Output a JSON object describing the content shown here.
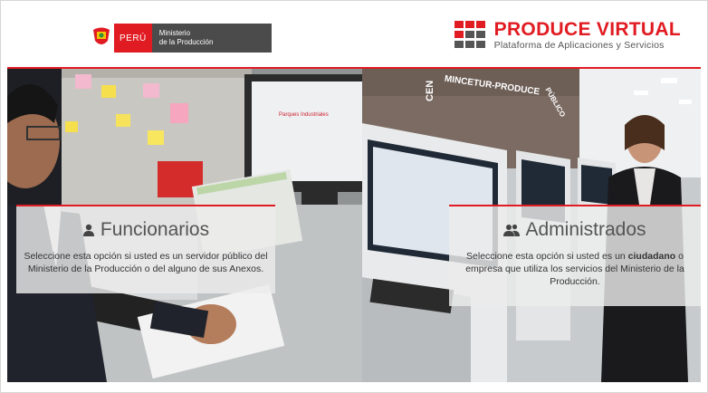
{
  "header": {
    "gov_logo": {
      "country": "PERÚ",
      "ministry_line1": "Ministerio",
      "ministry_line2": "de la Producción"
    },
    "brand": {
      "title": "PRODUCE VIRTUAL",
      "subtitle": "Plataforma de Aplicaciones y Servicios"
    }
  },
  "scene": {
    "monitor_text": "Parques Industriales",
    "wall_text_1": "MINCETUR-PRODUCE",
    "wall_text_2": "CEN",
    "wall_text_3": "PÚBLICO"
  },
  "options": [
    {
      "title": "Funcionarios",
      "icon": "user-icon",
      "description": "Seleccione esta opción si usted es un servidor público del Ministerio de la Producción o del alguno de sus Anexos."
    },
    {
      "title": "Administrados",
      "icon": "users-icon",
      "desc_before": "Seleccione esta opción si usted es un",
      "desc_bold": "ciudadano",
      "desc_after": "o empresa que utiliza los servicios del Ministerio de la Producción."
    }
  ],
  "colors": {
    "accent": "#e11b22",
    "gray_dark": "#4b4b4b"
  }
}
